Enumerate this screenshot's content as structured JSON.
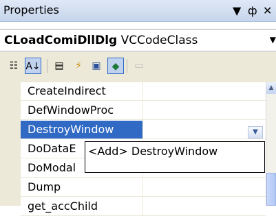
{
  "window": {
    "title": "Properties",
    "dropdown_glyph": "▼",
    "pin_glyph": "ф",
    "close_glyph": "✕"
  },
  "object_bar": {
    "object_name": "CLoadComiDllDlg",
    "object_type": "VCCodeClass",
    "dropdown_glyph": "▼"
  },
  "toolbar": {
    "buttons": [
      {
        "icon": "categorized-icon",
        "glyph": "☷"
      },
      {
        "icon": "alphabetical-sort-icon",
        "glyph": "A↓"
      },
      {
        "icon": "properties-icon",
        "glyph": "▤"
      },
      {
        "icon": "events-lightning-icon",
        "glyph": "⚡"
      },
      {
        "icon": "messages-icon",
        "glyph": "▣"
      },
      {
        "icon": "overrides-icon",
        "glyph": "◆"
      },
      {
        "icon": "property-pages-icon",
        "glyph": "▭"
      }
    ]
  },
  "grid": {
    "rows": [
      {
        "name": "CreateIndirect",
        "value": ""
      },
      {
        "name": "DefWindowProc",
        "value": ""
      },
      {
        "name": "DestroyWindow",
        "value": ""
      },
      {
        "name": "DoDataE",
        "value": ""
      },
      {
        "name": "DoModal",
        "value": ""
      },
      {
        "name": "Dump",
        "value": ""
      },
      {
        "name": "get_accChild",
        "value": ""
      }
    ],
    "selected_index": 2,
    "combo_glyph": "▼"
  },
  "popup": {
    "item": "<Add> DestroyWindow"
  },
  "scrollbar": {
    "up_glyph": "▲"
  }
}
